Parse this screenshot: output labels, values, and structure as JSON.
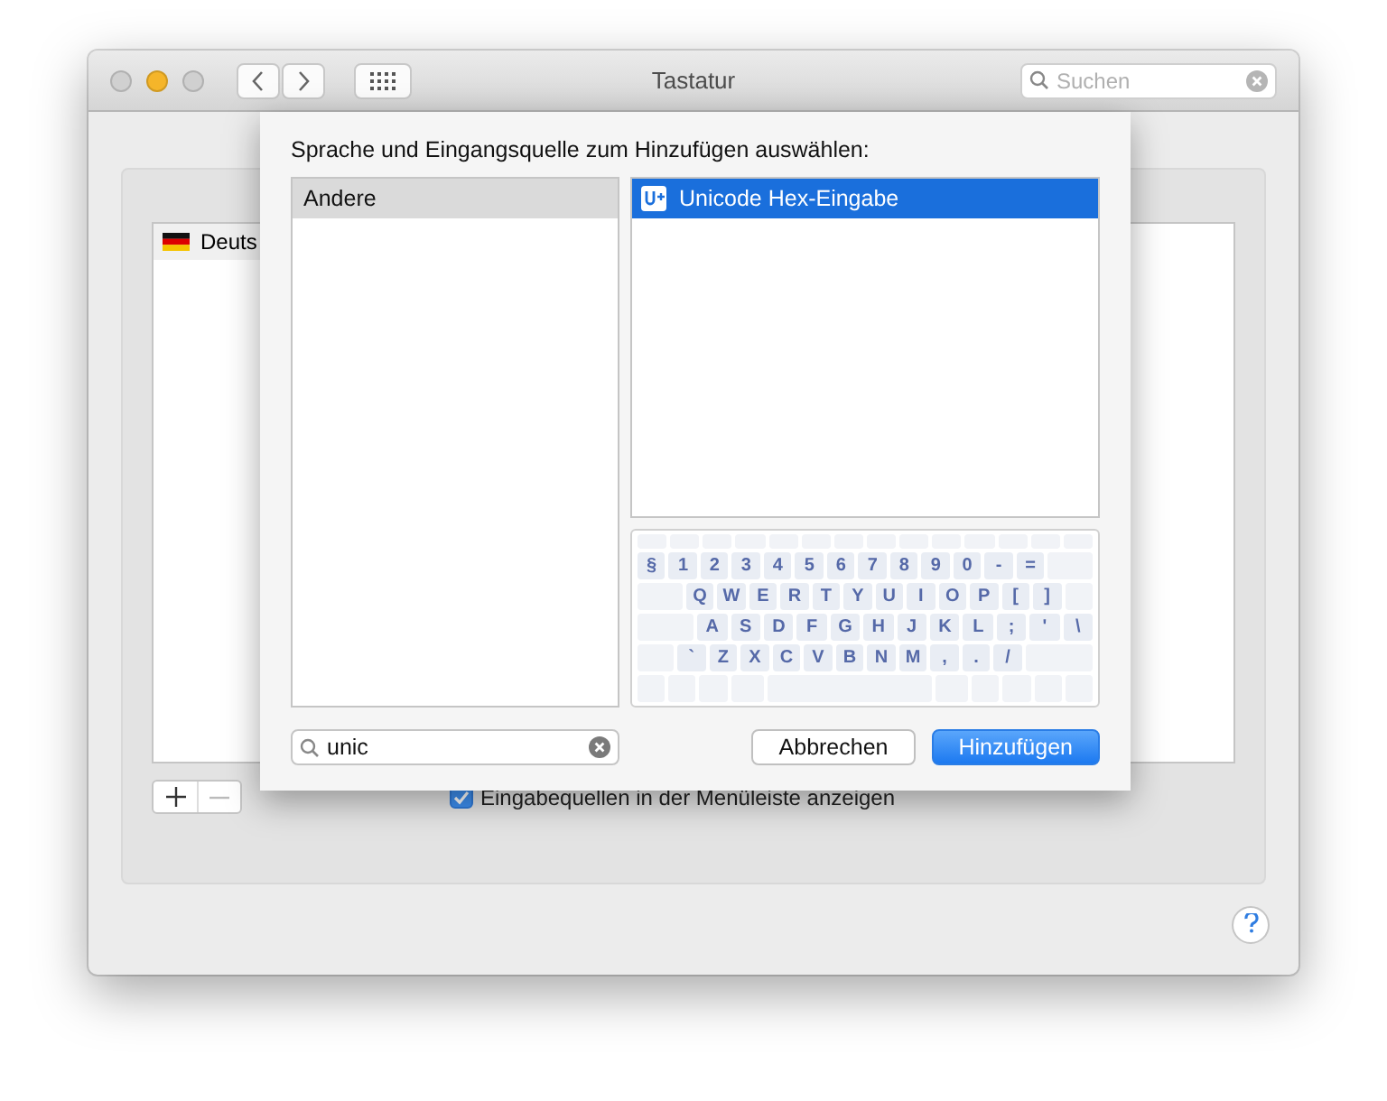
{
  "window": {
    "title": "Tastatur",
    "search": {
      "placeholder": "Suchen"
    }
  },
  "background_list": {
    "items": [
      {
        "label": "Deuts"
      }
    ]
  },
  "show_in_menubar": {
    "label": "Eingabequellen in der Menüleiste anzeigen",
    "checked": true
  },
  "sheet": {
    "heading": "Sprache und Eingangsquelle zum Hinzufügen auswählen:",
    "languages": [
      {
        "label": "Andere",
        "selected": true
      }
    ],
    "sources": [
      {
        "label": "Unicode Hex-Eingabe",
        "selected": true
      }
    ],
    "keyboard_rows": [
      [
        "§",
        "1",
        "2",
        "3",
        "4",
        "5",
        "6",
        "7",
        "8",
        "9",
        "0",
        "-",
        "="
      ],
      [
        "Q",
        "W",
        "E",
        "R",
        "T",
        "Y",
        "U",
        "I",
        "O",
        "P",
        "[",
        "]"
      ],
      [
        "A",
        "S",
        "D",
        "F",
        "G",
        "H",
        "J",
        "K",
        "L",
        ";",
        "'",
        "\\"
      ],
      [
        "`",
        "Z",
        "X",
        "C",
        "V",
        "B",
        "N",
        "M",
        ",",
        ".",
        "/"
      ]
    ],
    "search": {
      "value": "unic"
    },
    "buttons": [
      {
        "label": "Abbrechen",
        "kind": "secondary"
      },
      {
        "label": "Hinzufügen",
        "kind": "primary"
      }
    ]
  }
}
